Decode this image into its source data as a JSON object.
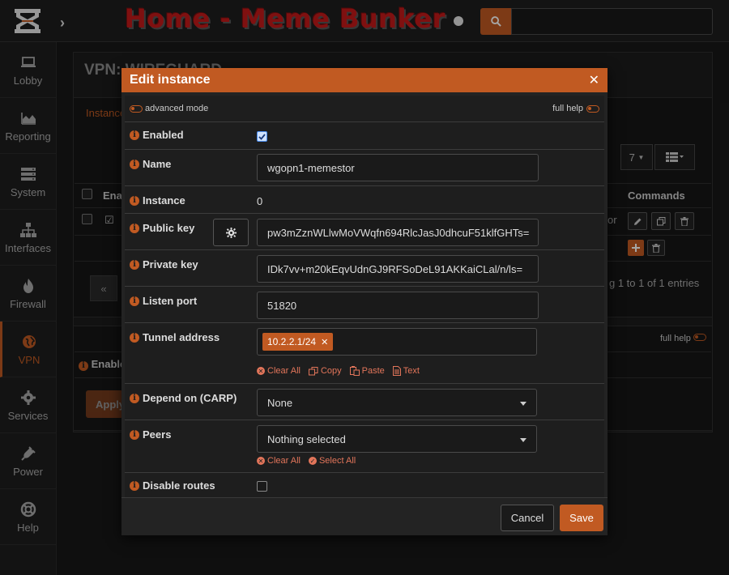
{
  "header": {
    "brand": "Home - Meme Bunker",
    "search_value": ""
  },
  "sidebar": {
    "items": [
      {
        "label": "Lobby",
        "icon": "laptop-icon"
      },
      {
        "label": "Reporting",
        "icon": "area-chart-icon"
      },
      {
        "label": "System",
        "icon": "server-icon"
      },
      {
        "label": "Interfaces",
        "icon": "sitemap-icon"
      },
      {
        "label": "Firewall",
        "icon": "fire-icon"
      },
      {
        "label": "VPN",
        "icon": "globe-icon",
        "active": true
      },
      {
        "label": "Services",
        "icon": "cog-icon"
      },
      {
        "label": "Power",
        "icon": "plug-icon"
      },
      {
        "label": "Help",
        "icon": "life-ring-icon"
      }
    ]
  },
  "background": {
    "page_title": "VPN: WIREGUARD",
    "tab_label": "Instances",
    "page_size": "7",
    "col_enabled": "Ena",
    "col_commands": "Commands",
    "row_suffix": "or",
    "entries_text": "g 1 to 1 of 1 entries",
    "prev_label": "«",
    "full_help": "full help",
    "enable_label": "Enable",
    "apply_label": "Apply"
  },
  "modal": {
    "title": "Edit instance",
    "advanced_mode_label": "advanced mode",
    "full_help_label": "full help",
    "fields": {
      "enabled": {
        "label": "Enabled",
        "checked": true
      },
      "name": {
        "label": "Name",
        "value": "wgopn1-memestor"
      },
      "instance": {
        "label": "Instance",
        "value": "0"
      },
      "public_key": {
        "label": "Public key",
        "value": "pw3mZznWLlwMoVWqfn694RlcJasJ0dhcuF51klfGHTs="
      },
      "private_key": {
        "label": "Private key",
        "value": "IDk7vv+m20kEqvUdnGJ9RFSoDeL91AKKaiCLal/n/ls="
      },
      "listen_port": {
        "label": "Listen port",
        "value": "51820"
      },
      "tunnel_address": {
        "label": "Tunnel address",
        "tag": "10.2.2.1/24",
        "actions": {
          "clear_all": "Clear All",
          "copy": "Copy",
          "paste": "Paste",
          "text": "Text"
        }
      },
      "depend_on": {
        "label": "Depend on (CARP)",
        "value": "None"
      },
      "peers": {
        "label": "Peers",
        "value": "Nothing selected",
        "actions": {
          "clear_all": "Clear All",
          "select_all": "Select All"
        }
      },
      "disable_routes": {
        "label": "Disable routes",
        "checked": false
      }
    },
    "buttons": {
      "cancel": "Cancel",
      "save": "Save"
    }
  },
  "colors": {
    "accent": "#c15a22",
    "brand_red": "#c41a1a",
    "background": "#181818"
  }
}
